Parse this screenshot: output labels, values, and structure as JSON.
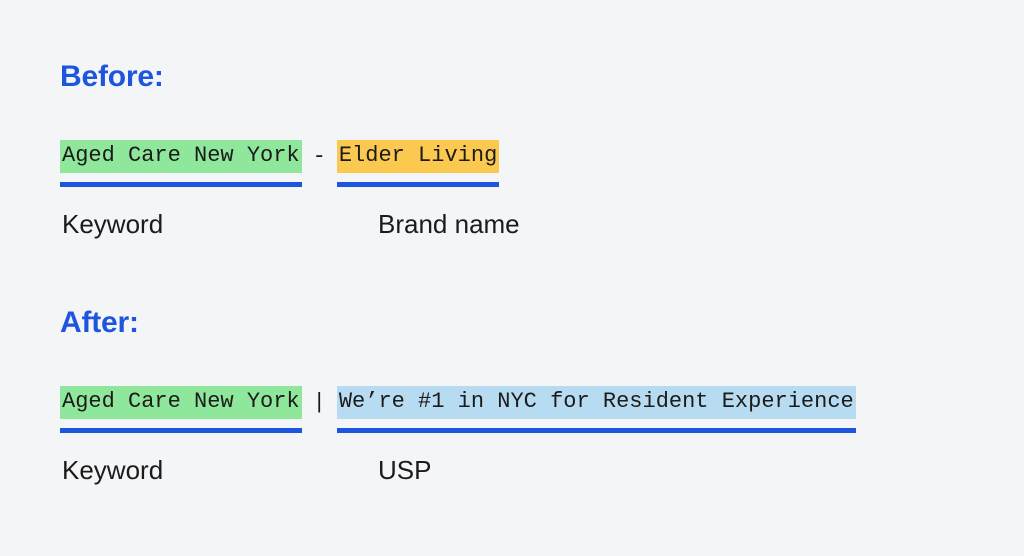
{
  "theme": {
    "background": "#f4f5f7",
    "heading_blue": "#1d55dd",
    "underline_blue": "#1d55dd",
    "text_dark": "#1b1b1b",
    "highlight_green": "#8fe79b",
    "highlight_amber": "#fbc94f",
    "highlight_blue": "#b7dcf2"
  },
  "sections": {
    "before": {
      "heading": "Before:",
      "separator": "-",
      "parts": [
        {
          "text": "Aged Care New York",
          "caption": "Keyword",
          "highlight": "green"
        },
        {
          "text": "Elder Living",
          "caption": "Brand name",
          "highlight": "amber"
        }
      ]
    },
    "after": {
      "heading": "After:",
      "separator": "|",
      "parts": [
        {
          "text": "Aged Care New York",
          "caption": "Keyword",
          "highlight": "green"
        },
        {
          "text": "We’re #1 in NYC for Resident Experience",
          "caption": "USP",
          "highlight": "blue"
        }
      ]
    }
  }
}
